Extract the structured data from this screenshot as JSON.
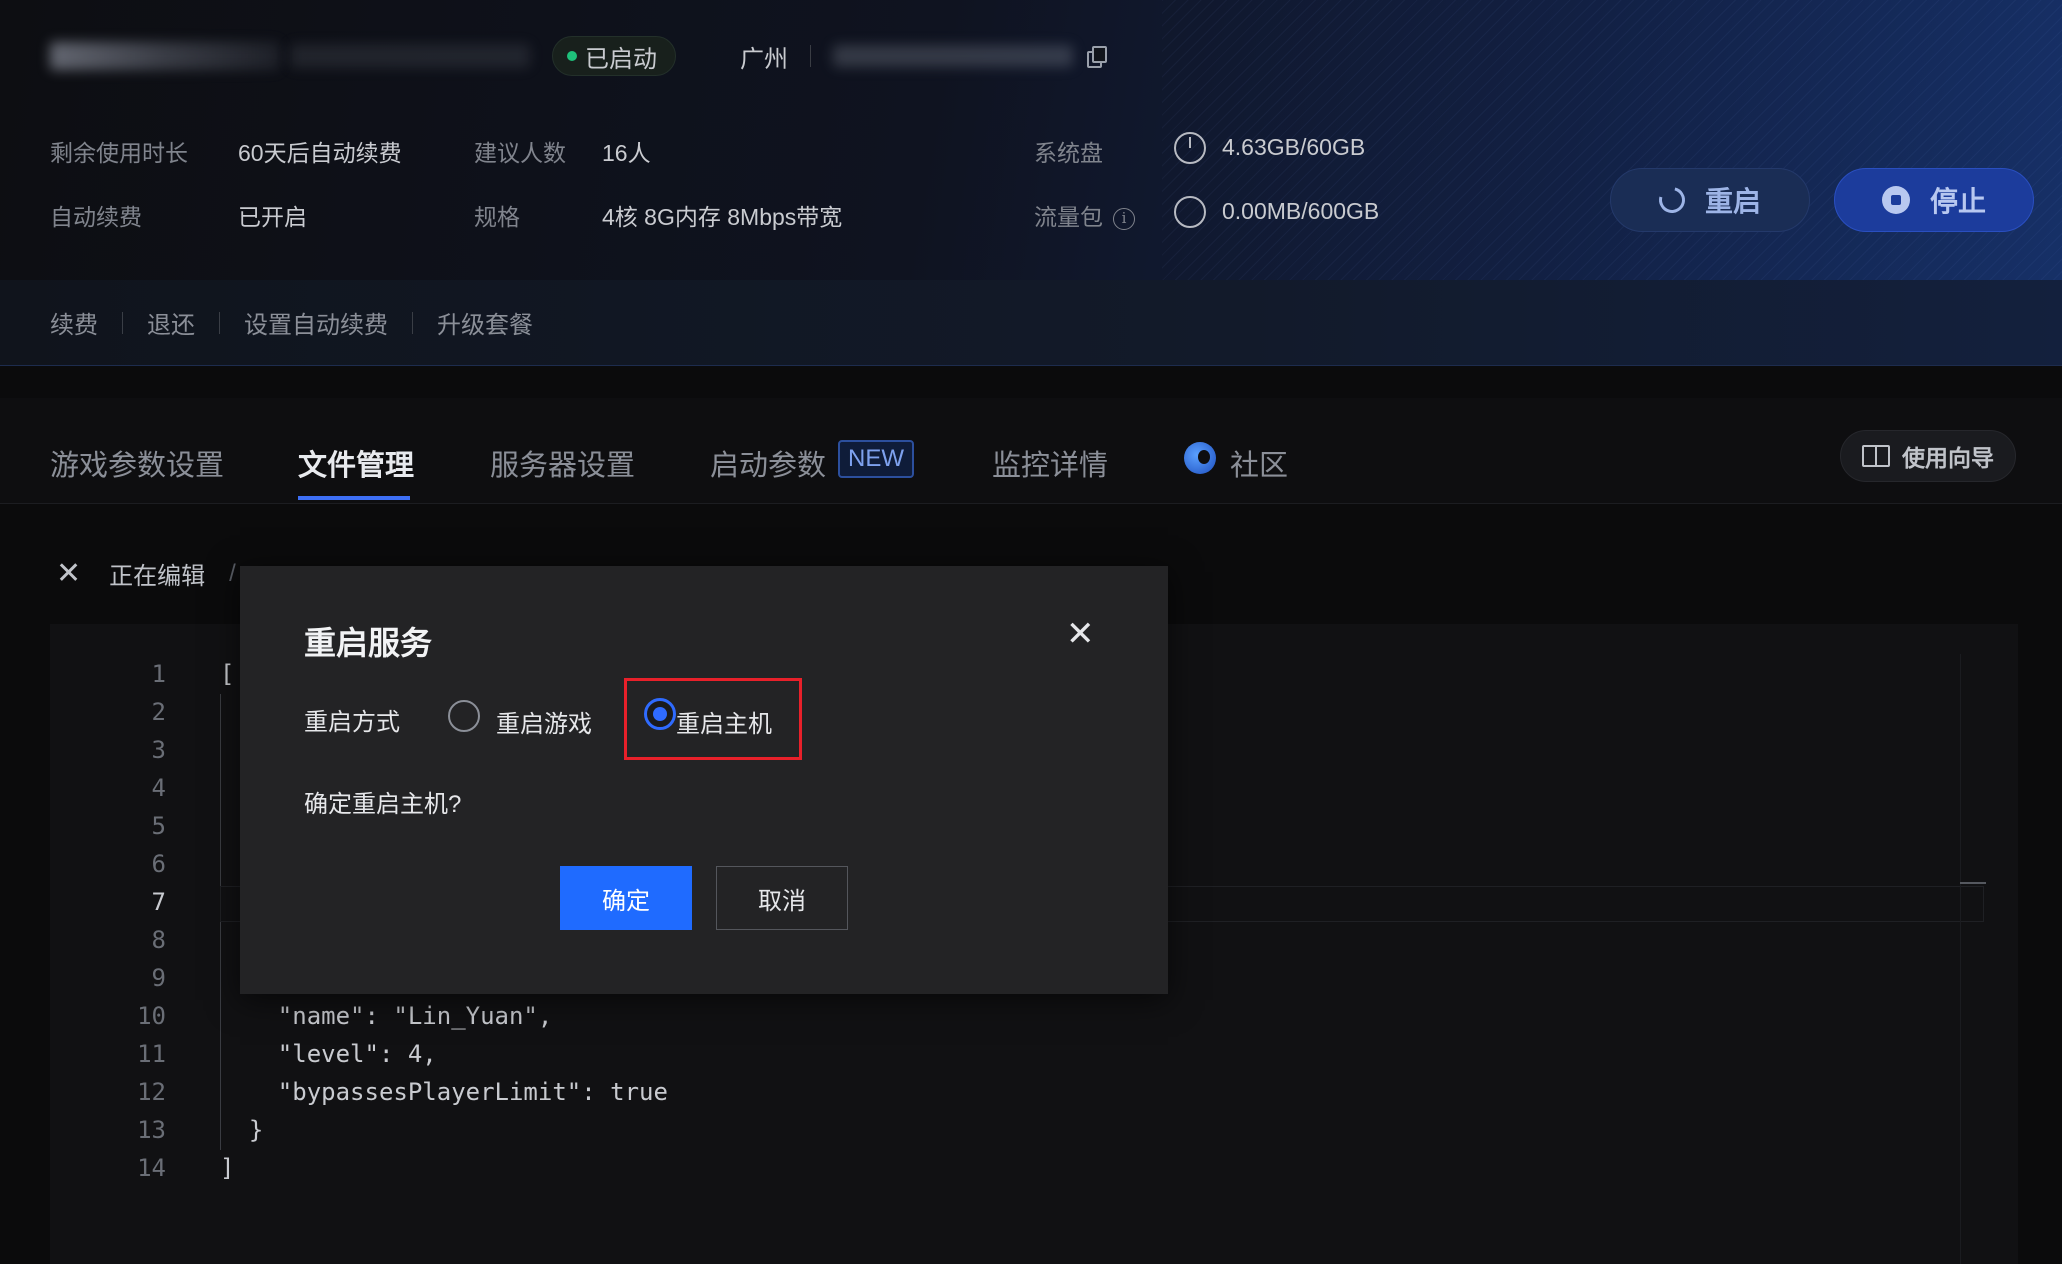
{
  "header": {
    "status": "已启动",
    "region": "广州",
    "info": {
      "remaining_label": "剩余使用时长",
      "remaining_value": "60天后自动续费",
      "players_label": "建议人数",
      "players_value": "16人",
      "disk_label": "系统盘",
      "disk_value": "4.63GB/60GB",
      "autorenew_label": "自动续费",
      "autorenew_value": "已开启",
      "spec_label": "规格",
      "spec_value": "4核 8G内存 8Mbps带宽",
      "traffic_label": "流量包",
      "traffic_value": "0.00MB/600GB"
    },
    "restart_label": "重启",
    "stop_label": "停止"
  },
  "actions": [
    "续费",
    "退还",
    "设置自动续费",
    "升级套餐"
  ],
  "tabs": {
    "items": [
      "游戏参数设置",
      "文件管理",
      "服务器设置",
      "启动参数",
      "监控详情",
      "社区"
    ],
    "new_badge": "NEW",
    "guide_label": "使用向导"
  },
  "editor": {
    "editing_label": "正在编辑",
    "line_numbers": [
      "1",
      "2",
      "3",
      "4",
      "5",
      "6",
      "7",
      "8",
      "9",
      "10",
      "11",
      "12",
      "13",
      "14"
    ],
    "visible_code": {
      "line1": "[",
      "line10": "    \"name\": \"Lin_Yuan\",",
      "line11": "    \"level\": 4,",
      "line12": "    \"bypassesPlayerLimit\": true",
      "line13": "  }",
      "line14": "]"
    }
  },
  "dialog": {
    "title": "重启服务",
    "close_icon": "close-icon",
    "mode_label": "重启方式",
    "option_game": "重启游戏",
    "option_host": "重启主机",
    "selected": "重启主机",
    "message": "确定重启主机?",
    "ok_label": "确定",
    "cancel_label": "取消"
  },
  "colors": {
    "accent": "#1f6bff",
    "status_green": "#1ec07a",
    "highlight_red": "#e8202a"
  }
}
